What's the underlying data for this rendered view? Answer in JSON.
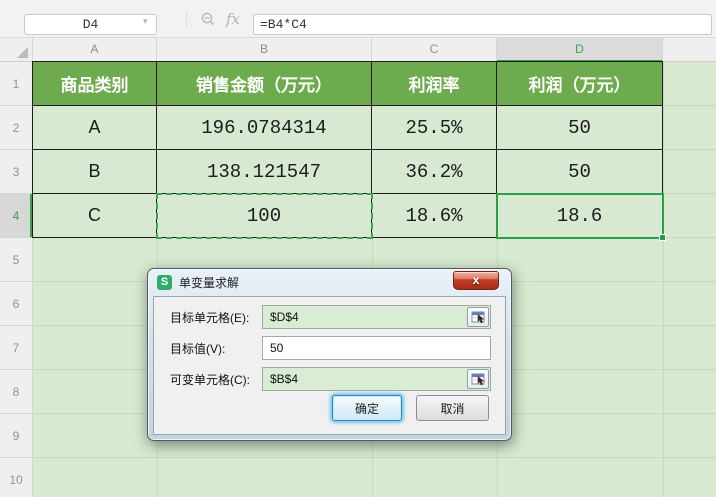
{
  "topbar": {
    "name_box": "D4",
    "formula": "=B4*C4"
  },
  "grid": {
    "column_headers": [
      "A",
      "B",
      "C",
      "D"
    ],
    "row_headers": [
      "1",
      "2",
      "3",
      "4",
      "5",
      "6",
      "7",
      "8",
      "9",
      "10"
    ],
    "selected_cell": "D4"
  },
  "table": {
    "header_row": [
      "商品类别",
      "销售金额（万元）",
      "利润率",
      "利润（万元）"
    ],
    "rows": [
      [
        "A",
        "196.0784314",
        "25.5%",
        "50"
      ],
      [
        "B",
        "138.121547",
        "36.2%",
        "50"
      ],
      [
        "C",
        "100",
        "18.6%",
        "18.6"
      ]
    ]
  },
  "dialog": {
    "title": "单变量求解",
    "app_icon_letter": "S",
    "close_label": "x",
    "fields": [
      {
        "label": "目标单元格(E):",
        "value": "$D$4"
      },
      {
        "label": "目标值(V):",
        "value": "50"
      },
      {
        "label": "可变单元格(C):",
        "value": "$B$4"
      }
    ],
    "ok_label": "确定",
    "cancel_label": "取消"
  },
  "colors": {
    "header_green": "#6eab4f",
    "cell_green": "#d7e9d0",
    "selection_green": "#28a04a",
    "close_red": "#c2402a"
  }
}
